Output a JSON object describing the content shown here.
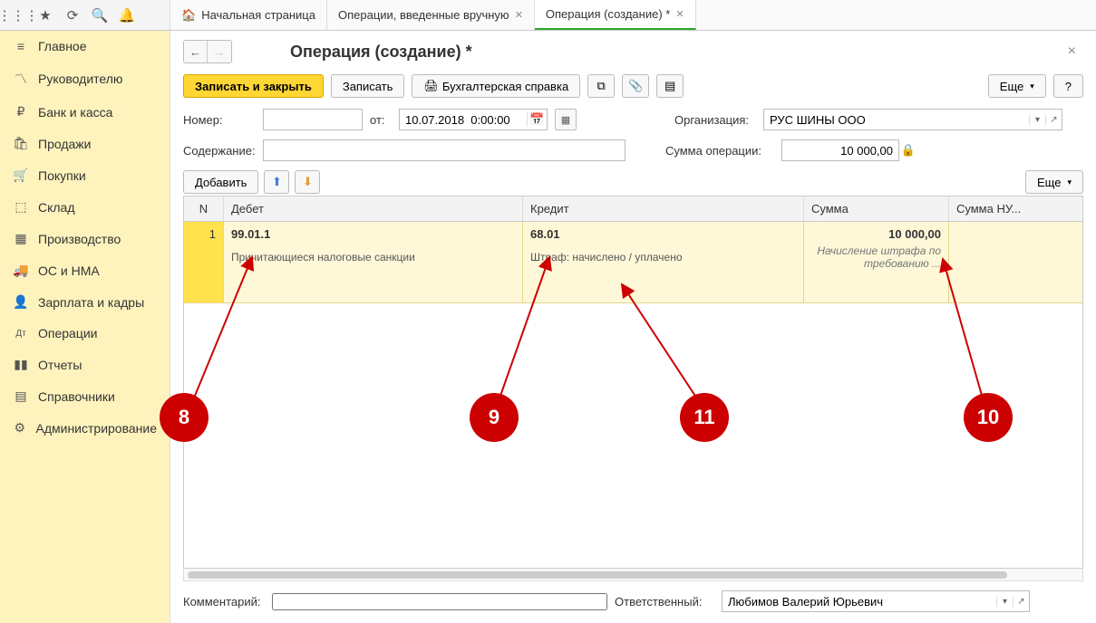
{
  "tabs": [
    {
      "label": "Начальная страница",
      "icon": "home"
    },
    {
      "label": "Операции, введенные вручную",
      "closable": true
    },
    {
      "label": "Операция (создание) *",
      "closable": true,
      "active": true
    }
  ],
  "sidebar": {
    "items": [
      {
        "label": "Главное",
        "icon": "≡"
      },
      {
        "label": "Руководителю",
        "icon": "📈"
      },
      {
        "label": "Банк и касса",
        "icon": "₽"
      },
      {
        "label": "Продажи",
        "icon": "🛍"
      },
      {
        "label": "Покупки",
        "icon": "🛒"
      },
      {
        "label": "Склад",
        "icon": "📦"
      },
      {
        "label": "Производство",
        "icon": "🏭"
      },
      {
        "label": "ОС и НМА",
        "icon": "🚚"
      },
      {
        "label": "Зарплата и кадры",
        "icon": "👥"
      },
      {
        "label": "Операции",
        "icon": "Дт"
      },
      {
        "label": "Отчеты",
        "icon": "📊"
      },
      {
        "label": "Справочники",
        "icon": "🗂"
      },
      {
        "label": "Администрирование",
        "icon": "⚙"
      }
    ]
  },
  "page": {
    "title": "Операция (создание) *",
    "toolbar": {
      "save_close": "Записать и закрыть",
      "save": "Записать",
      "report": "Бухгалтерская справка",
      "more": "Еще",
      "help": "?"
    },
    "form": {
      "number_label": "Номер:",
      "number": "",
      "from_label": "от:",
      "date": "10.07.2018  0:00:00",
      "org_label": "Организация:",
      "org": "РУС ШИНЫ ООО",
      "content_label": "Содержание:",
      "content": "",
      "sum_label": "Сумма операции:",
      "sum": "10 000,00"
    },
    "table_toolbar": {
      "add": "Добавить",
      "more": "Еще"
    },
    "grid": {
      "headers": {
        "n": "N",
        "debit": "Дебет",
        "credit": "Кредит",
        "sum": "Сумма",
        "sum_nu": "Сумма НУ..."
      },
      "rows": [
        {
          "n": "1",
          "debit_acct": "99.01.1",
          "debit_desc": "Причитающиеся налоговые санкции",
          "credit_acct": "68.01",
          "credit_desc": "Штраф: начислено / уплачено",
          "amount": "10 000,00",
          "note": "Начисление штрафа по требованию ..."
        }
      ]
    },
    "footer": {
      "comment_label": "Комментарий:",
      "comment": "",
      "responsible_label": "Ответственный:",
      "responsible": "Любимов Валерий Юрьевич"
    }
  },
  "callouts": {
    "c8": "8",
    "c9": "9",
    "c10": "10",
    "c11": "11"
  }
}
